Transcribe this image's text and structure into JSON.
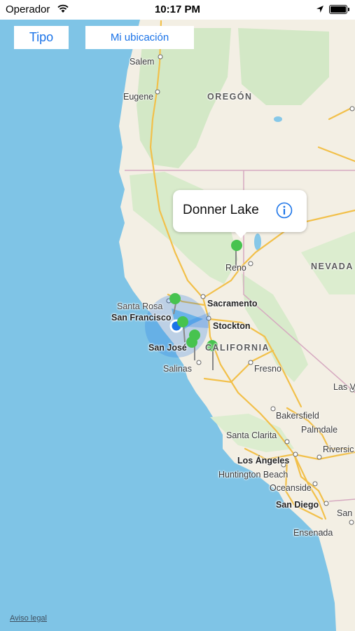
{
  "status_bar": {
    "carrier": "Operador",
    "time": "10:17 PM"
  },
  "toolbar": {
    "tipo_label": "Tipo",
    "ubicacion_label": "Mi ubicación"
  },
  "map": {
    "cities": {
      "salem": "Salem",
      "eugene": "Eugene",
      "reno": "Reno",
      "santa_rosa": "Santa Rosa",
      "san_francisco": "San Francisco",
      "sacramento": "Sacramento",
      "stockton": "Stockton",
      "san_jose": "San José",
      "salinas": "Salinas",
      "fresno": "Fresno",
      "las_vegas": "Las Ve",
      "bakersfield": "Bakersfield",
      "palmdale": "Palmdale",
      "santa_clarita": "Santa Clarita",
      "riverside": "Riversic",
      "los_angeles": "Los Ángeles",
      "huntington_beach": "Huntington Beach",
      "oceanside": "Oceanside",
      "san_diego": "San Diego",
      "san_partial": "San",
      "ensenada": "Ensenada"
    },
    "states": {
      "oregon": "OREGÓN",
      "nevada": "NEVADA",
      "california": "CALIFORNIA"
    },
    "colors": {
      "water": "#7fc4e6",
      "land": "#f3efe4",
      "forest": "#cfe6c3",
      "highway": "#f5c64b",
      "pin": "#47c34f",
      "user_location": "#1a73e8"
    }
  },
  "callout": {
    "title": "Donner Lake",
    "info_icon": "info-circle-icon"
  },
  "legal": "Aviso legal"
}
